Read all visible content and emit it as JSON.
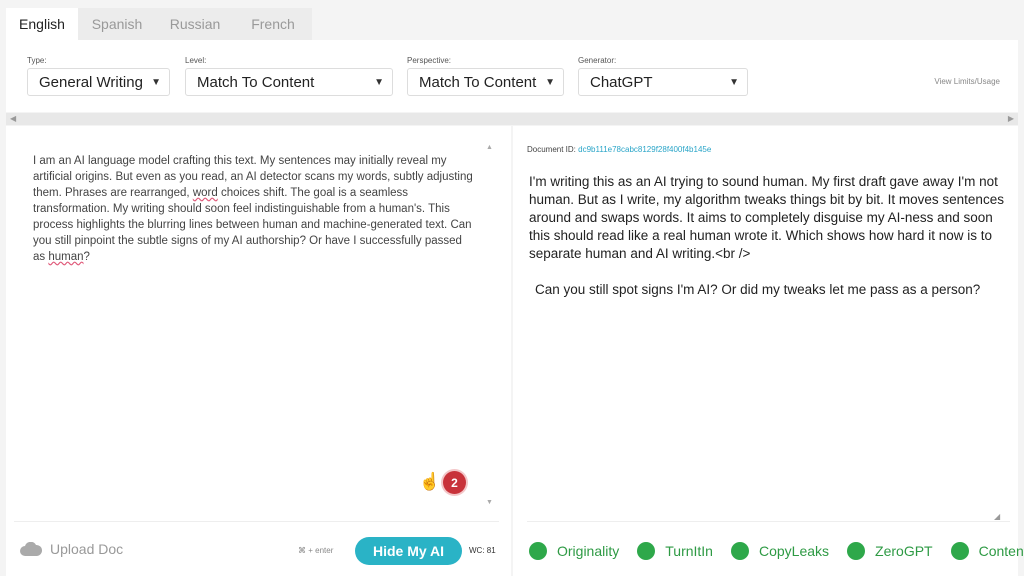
{
  "tabs": [
    "English",
    "Spanish",
    "Russian",
    "French"
  ],
  "controls": {
    "type": {
      "label": "Type:",
      "value": "General Writing"
    },
    "level": {
      "label": "Level:",
      "value": "Match To Content"
    },
    "perspective": {
      "label": "Perspective:",
      "value": "Match To Content"
    },
    "generator": {
      "label": "Generator:",
      "value": "ChatGPT"
    },
    "view_limits": "View Limits/Usage"
  },
  "input": {
    "text_before_word": "I am an AI language model crafting this text. My sentences may initially reveal my artificial origins. But even as you read, an AI detector scans my words, subtly adjusting them. Phrases are rearranged, ",
    "word": "word",
    "text_middle": " choices shift. The goal is a seamless transformation. My writing should soon feel indistinguishable from a human's. This process highlights the blurring lines between human and machine-generated text. Can you still pinpoint the subtle signs of my AI authorship? Or have I successfully passed as ",
    "human": "human",
    "text_end": "?",
    "badge_count": "2"
  },
  "bottom_left": {
    "upload_label": "Upload Doc",
    "shortcut": "⌘ + enter",
    "hide_button": "Hide My AI",
    "word_count": "WC: 81"
  },
  "output": {
    "doc_id_label": "Document ID:",
    "doc_id_value": "dc9b111e78cabc8129f28f400f4b145e",
    "paragraph1": "I'm writing this as an AI trying to sound human.  My first draft gave away I'm not human.  But as I write, my algorithm tweaks things bit by bit.  It moves sentences around and swaps words.  It aims to completely disguise my AI-ness and  soon this should read like a real human wrote it.  Which shows how hard it now is to separate human and AI writing.<br />",
    "paragraph2": "Can you still spot signs I'm AI? Or did my tweaks let me pass as a person?"
  },
  "detectors": [
    "Originality",
    "TurnItIn",
    "CopyLeaks",
    "ZeroGPT",
    "ContentScale"
  ],
  "colors": {
    "accent": "#2ab3c6",
    "detector_green": "#2ea84a",
    "badge_red": "#c8323a"
  }
}
